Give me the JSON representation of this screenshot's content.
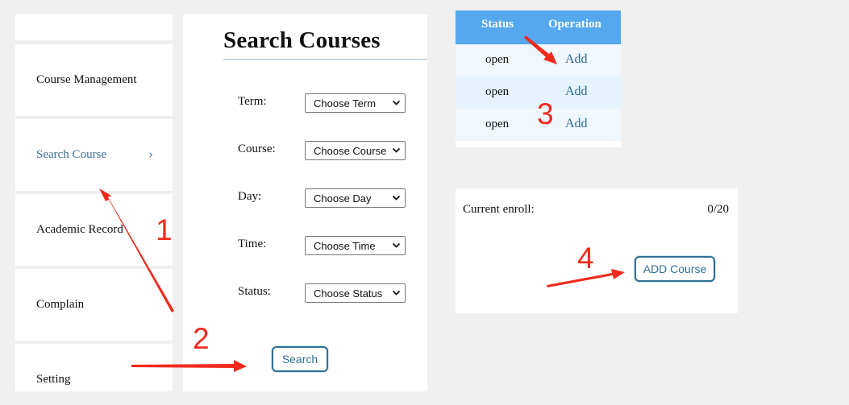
{
  "sidebar": {
    "items": [
      {
        "label": "Course Management"
      },
      {
        "label": "Search Course",
        "chevron": "›"
      },
      {
        "label": "Academic Record"
      },
      {
        "label": "Complain"
      },
      {
        "label": "Setting"
      }
    ]
  },
  "search_panel": {
    "title": "Search Courses",
    "fields": [
      {
        "label": "Term:",
        "value": "Choose Term"
      },
      {
        "label": "Course:",
        "value": "Choose Course"
      },
      {
        "label": "Day:",
        "value": "Choose Day"
      },
      {
        "label": "Time:",
        "value": "Choose Time"
      },
      {
        "label": "Status:",
        "value": "Choose Status"
      }
    ],
    "search_label": "Search"
  },
  "table": {
    "headers": [
      "Status",
      "Operation"
    ],
    "rows": [
      {
        "status": "open",
        "operation": "Add"
      },
      {
        "status": "open",
        "operation": "Add"
      },
      {
        "status": "open",
        "operation": "Add"
      }
    ]
  },
  "enroll": {
    "label": "Current enroll:",
    "value": "0/20",
    "add_label": "ADD Course"
  },
  "annotations": {
    "step1": "1",
    "step2": "2",
    "step3": "3",
    "step4": "4"
  },
  "colors": {
    "accent": "#2f6f95",
    "table_header": "#55a8ee",
    "annotation": "#f02a1e",
    "background": "#f0f0f0"
  }
}
